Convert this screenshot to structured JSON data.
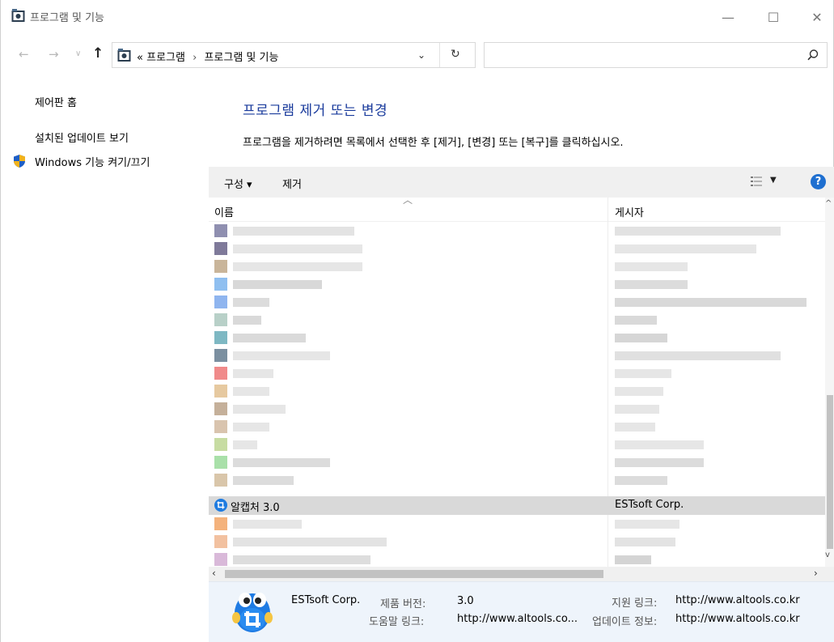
{
  "window": {
    "title": "프로그램 및 기능",
    "minimize_glyph": "—",
    "maximize_glyph": "☐",
    "close_glyph": "✕"
  },
  "nav": {
    "breadcrumb_prefix": "«",
    "breadcrumb": [
      "프로그램",
      "프로그램 및 기능"
    ],
    "separator": "›",
    "search_placeholder": ""
  },
  "sidebar": {
    "items": [
      {
        "label": "제어판 홈"
      },
      {
        "label": "설치된 업데이트 보기"
      },
      {
        "label": "Windows 기능 켜기/끄기"
      }
    ]
  },
  "main": {
    "heading": "프로그램 제거 또는 변경",
    "description": "프로그램을 제거하려면 목록에서 선택한 후 [제거], [변경] 또는 [복구]를 클릭하십시오."
  },
  "toolbar": {
    "organize_label": "구성 ▾",
    "remove_label": "제거",
    "help_label": "?"
  },
  "list": {
    "columns": {
      "name": "이름",
      "publisher": "게시자"
    },
    "selected": {
      "name": "알캡처 3.0",
      "publisher": "ESTsoft Corp."
    }
  },
  "details": {
    "publisher": "ESTsoft Corp.",
    "product_version_label": "제품 버전:",
    "product_version": "3.0",
    "support_link_label": "지원 링크:",
    "support_link": "http://www.altools.co.kr",
    "help_link_label": "도움말 링크:",
    "help_link": "http://www.altools.co...",
    "update_info_label": "업데이트 정보:",
    "update_info": "http://www.altools.co.kr"
  },
  "colors": {
    "heading": "#1a3b9c",
    "selection": "#d9d9d9",
    "details_bg": "#eef4fb",
    "help_icon": "#1e6fd0"
  }
}
